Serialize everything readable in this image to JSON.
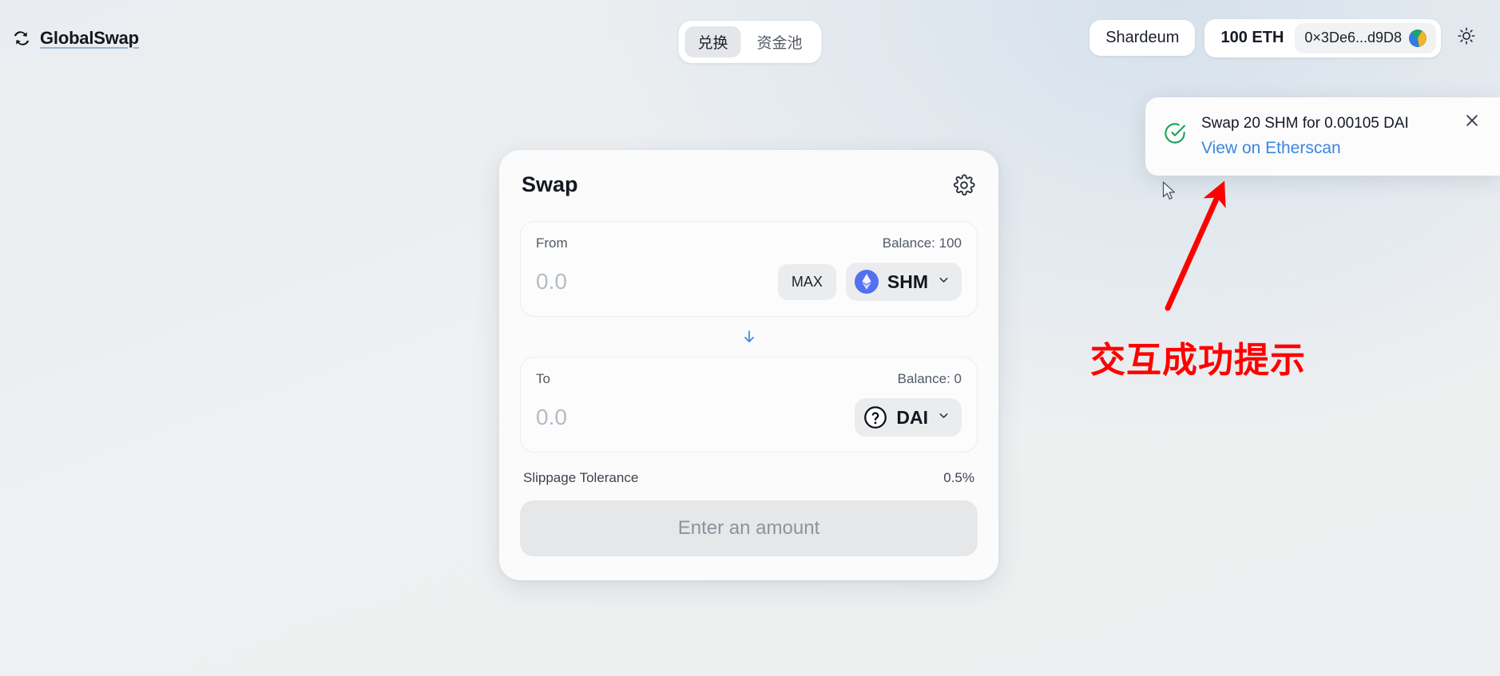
{
  "header": {
    "brand": {
      "name": "GlobalSwap",
      "icon": "swap-arrows-icon"
    },
    "tabs": [
      {
        "label": "兑换",
        "active": true
      },
      {
        "label": "资金池",
        "active": false
      }
    ],
    "chain": "Shardeum",
    "balance": "100 ETH",
    "address": "0×3De6...d9D8",
    "avatar_icon": "account-blockie-avatar",
    "theme_toggle_icon": "sun-icon"
  },
  "swap_card": {
    "title": "Swap",
    "settings_icon": "gear-icon",
    "from": {
      "label": "From",
      "balance": "Balance: 100",
      "amount_value": "",
      "amount_placeholder": "0.0",
      "max_label": "MAX",
      "token": "SHM",
      "token_icon": "ethereum-diamond-icon",
      "chevron_icon": "chevron-down-icon"
    },
    "direction_icon": "arrow-down-icon",
    "to": {
      "label": "To",
      "balance": "Balance: 0",
      "amount_value": "",
      "amount_placeholder": "0.0",
      "token": "DAI",
      "token_icon": "question-circle-icon",
      "chevron_icon": "chevron-down-icon"
    },
    "slippage": {
      "label": "Slippage Tolerance",
      "value": "0.5%"
    },
    "action_label": "Enter an amount"
  },
  "toast": {
    "status_icon": "check-circle-icon",
    "message": "Swap 20 SHM for 0.00105 DAI",
    "link_label": "View on Etherscan",
    "close_icon": "close-icon"
  },
  "annotation": {
    "text": "交互成功提示",
    "color": "#ff0000",
    "arrow_icon": "red-arrow-icon"
  },
  "colors": {
    "accent_blue": "#3b86df",
    "token_blue": "#5470f0",
    "success_green": "#1ba35d",
    "annotation_red": "#ff0000"
  }
}
